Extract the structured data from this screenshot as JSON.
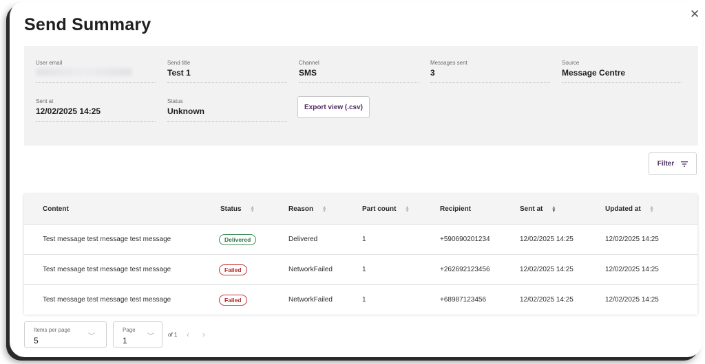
{
  "dialog": {
    "title": "Send Summary",
    "close_glyph": "✕"
  },
  "summary": {
    "user_email": {
      "label": "User email",
      "value": ""
    },
    "send_title": {
      "label": "Send title",
      "value": "Test 1"
    },
    "channel": {
      "label": "Channel",
      "value": "SMS"
    },
    "messages_sent": {
      "label": "Messages sent",
      "value": "3"
    },
    "source": {
      "label": "Source",
      "value": "Message Centre"
    },
    "sent_at": {
      "label": "Sent at",
      "value": "12/02/2025 14:25"
    },
    "status": {
      "label": "Status",
      "value": "Unknown"
    },
    "export_label": "Export view (.csv)"
  },
  "filter": {
    "label": "Filter",
    "icon": "filter-icon"
  },
  "table": {
    "columns": {
      "content": "Content",
      "status": "Status",
      "reason": "Reason",
      "part_count": "Part count",
      "recipient": "Recipient",
      "sent_at": "Sent at",
      "updated_at": "Updated at"
    },
    "rows": [
      {
        "content": "Test message test message test message",
        "status": "Delivered",
        "reason": "Delivered",
        "part_count": "1",
        "recipient": "+590690201234",
        "sent_at": "12/02/2025 14:25",
        "updated_at": "12/02/2025 14:25"
      },
      {
        "content": "Test message test message test message",
        "status": "Failed",
        "reason": "NetworkFailed",
        "part_count": "1",
        "recipient": "+262692123456",
        "sent_at": "12/02/2025 14:25",
        "updated_at": "12/02/2025 14:25"
      },
      {
        "content": "Test message test message test message",
        "status": "Failed",
        "reason": "NetworkFailed",
        "part_count": "1",
        "recipient": "+68987123456",
        "sent_at": "12/02/2025 14:25",
        "updated_at": "12/02/2025 14:25"
      }
    ]
  },
  "pagination": {
    "items_per_page": {
      "label": "Items per page",
      "value": "5"
    },
    "page": {
      "label": "Page",
      "value": "1"
    },
    "of_text": "of 1"
  },
  "colors": {
    "accent": "#4b2c5e",
    "delivered": "#3c8a57",
    "failed": "#c23030",
    "panel_bg": "#f2f2f3"
  }
}
